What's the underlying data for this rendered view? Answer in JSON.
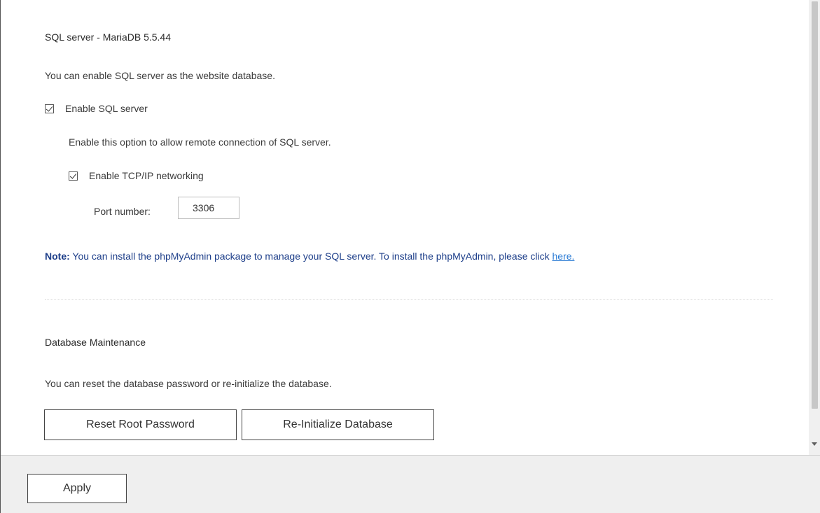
{
  "sql_section": {
    "title": "SQL server - MariaDB 5.5.44",
    "description": "You can enable SQL server as the website database.",
    "enable_sql_label": "Enable SQL server",
    "enable_sql_checked": true,
    "remote_description": "Enable this option to allow remote connection of SQL server.",
    "enable_tcpip_label": "Enable TCP/IP networking",
    "enable_tcpip_checked": true,
    "port_label": "Port number:",
    "port_value": "3306"
  },
  "note": {
    "prefix": "Note:",
    "text": " You can install the phpMyAdmin package to manage your SQL server. To install the phpMyAdmin, please click ",
    "link_label": "here."
  },
  "maintenance": {
    "title": "Database Maintenance",
    "description": "You can reset the database password or re-initialize the database.",
    "reset_button": "Reset Root Password",
    "reinit_button": "Re-Initialize Database"
  },
  "footer": {
    "apply_button": "Apply"
  },
  "icons": {
    "checkbox": "checkbox-checked-icon",
    "scroll_down": "chevron-down-icon"
  }
}
